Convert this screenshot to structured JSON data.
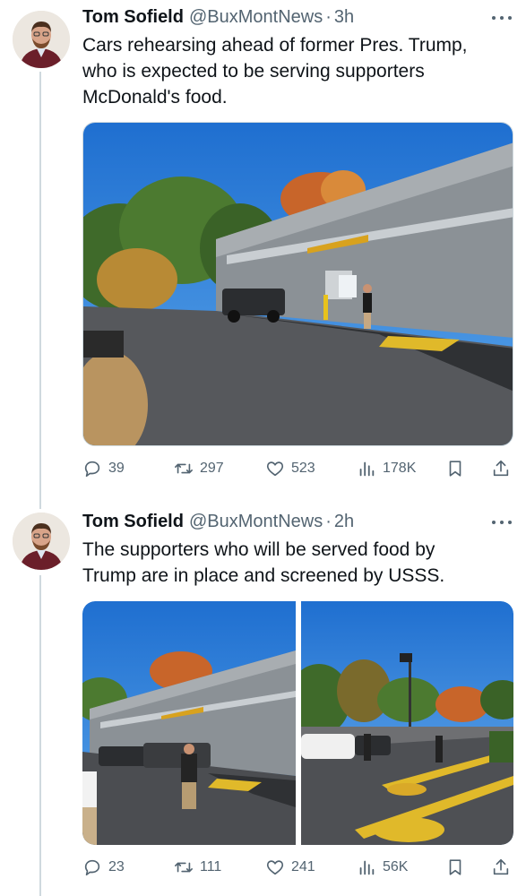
{
  "tweets": [
    {
      "name": "Tom Sofield",
      "handle": "@BuxMontNews",
      "separator": "·",
      "time": "3h",
      "text_lines": [
        "Cars rehearsing ahead of former Pres. Trump,",
        "who is expected to be serving supporters",
        "McDonald's food."
      ],
      "replies": "39",
      "retweets": "297",
      "likes": "523",
      "views": "178K"
    },
    {
      "name": "Tom Sofield",
      "handle": "@BuxMontNews",
      "separator": "·",
      "time": "2h",
      "text_lines": [
        "The supporters who will be served food by",
        "Trump are in place and screened by USSS."
      ],
      "replies": "23",
      "retweets": "111",
      "likes": "241",
      "views": "56K"
    }
  ],
  "icons": {
    "reply": "reply-icon",
    "retweet": "retweet-icon",
    "like": "heart-icon",
    "views": "views-bar-chart-icon",
    "bookmark": "bookmark-icon",
    "share": "share-icon",
    "more": "more-dots-icon"
  },
  "colors": {
    "text": "#0f1419",
    "secondary": "#536471",
    "thread_line": "#cfd9de",
    "sky": "#2f7fd6",
    "building": "#8b9196"
  }
}
